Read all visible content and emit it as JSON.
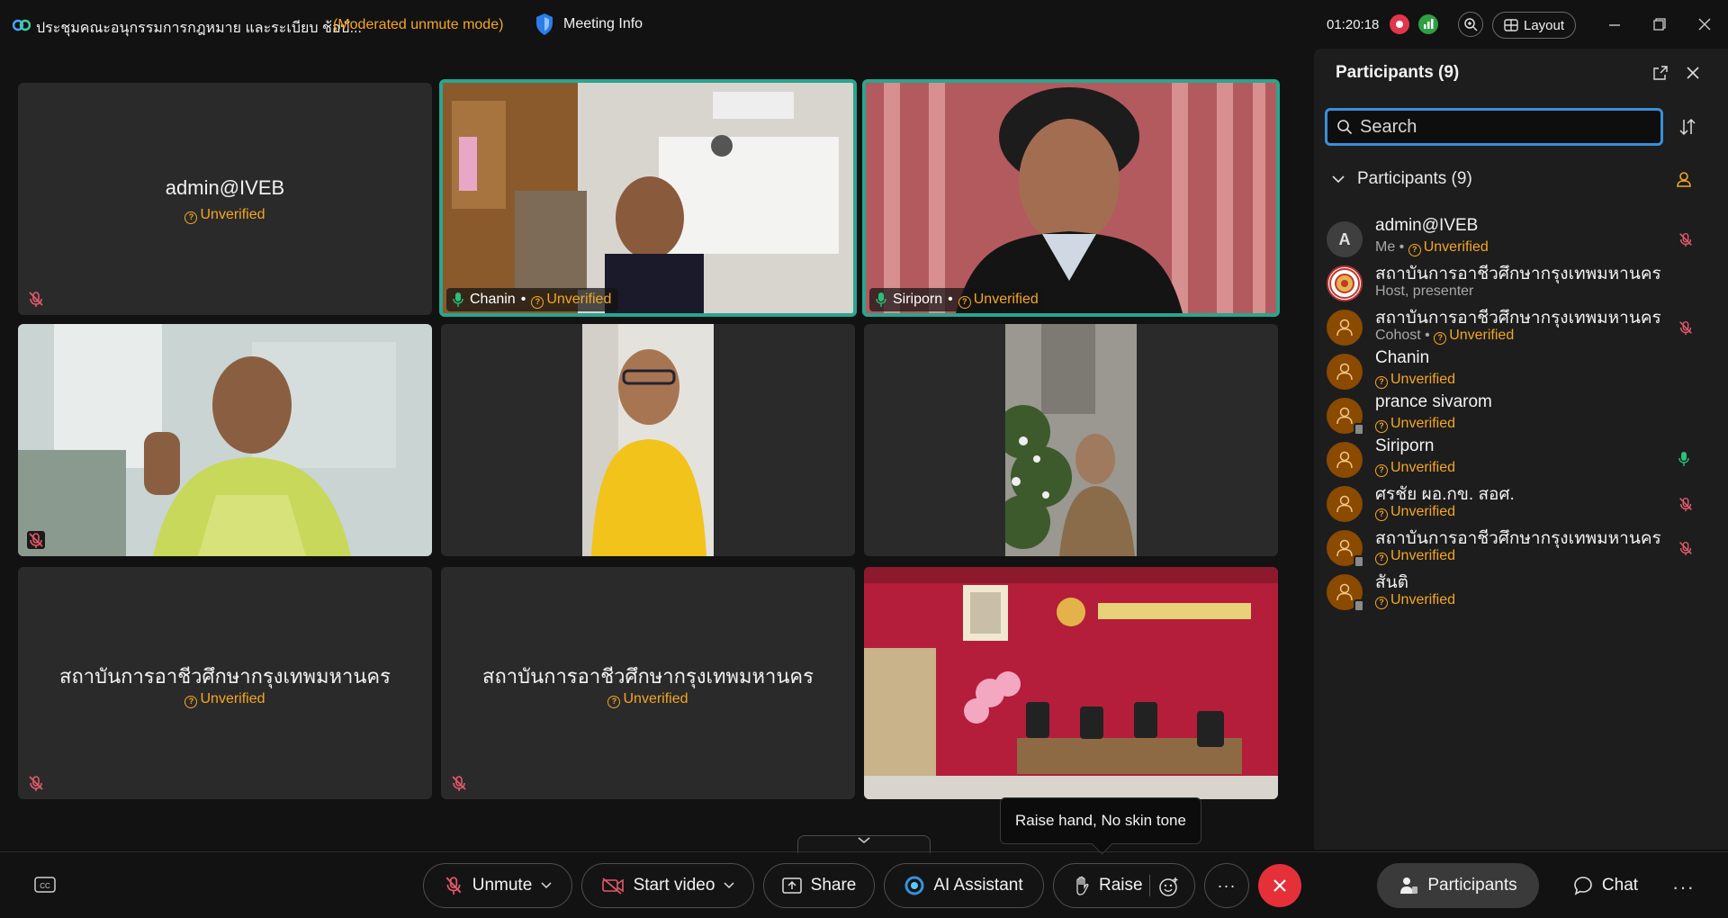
{
  "topbar": {
    "title": "ประชุมคณะอนุกรรมการกฎหมาย และระเบียบ ช้อบั...",
    "mode": "(Moderated unmute mode)",
    "meeting_info": "Meeting Info",
    "timer": "01:20:18",
    "layout": "Layout"
  },
  "tiles": [
    {
      "name": "admin@IVEB",
      "status": "Unverified",
      "muted": true,
      "video": false
    },
    {
      "name": "Chanin",
      "status": "Unverified",
      "muted": false,
      "video": true,
      "active": true
    },
    {
      "name": "Siriporn",
      "status": "Unverified",
      "muted": false,
      "video": true,
      "active": true
    },
    {
      "name": "",
      "status": "",
      "muted": true,
      "video": true
    },
    {
      "name": "",
      "status": "",
      "muted": false,
      "video": true
    },
    {
      "name": "",
      "status": "",
      "muted": false,
      "video": true
    },
    {
      "name": "สถาบันการอาชีวศึกษากรุงเทพมหานคร",
      "status": "Unverified",
      "muted": true,
      "video": false
    },
    {
      "name": "สถาบันการอาชีวศึกษากรุงเทพมหานคร",
      "status": "Unverified",
      "muted": true,
      "video": false
    },
    {
      "name": "",
      "status": "",
      "muted": false,
      "video": true
    }
  ],
  "panel": {
    "title": "Participants (9)",
    "search_placeholder": "Search",
    "section_label": "Participants (9)",
    "participants": [
      {
        "name": "admin@IVEB",
        "prefix": "Me • ",
        "status": "Unverified",
        "avatar": "A",
        "mic": "muted"
      },
      {
        "name": "สถาบันการอาชีวศึกษากรุงเทพมหานคร",
        "prefix": "Host, presenter",
        "status": "",
        "avatar": "logo",
        "mic": "none"
      },
      {
        "name": "สถาบันการอาชีวศึกษากรุงเทพมหานคร",
        "prefix": "Cohost • ",
        "status": "Unverified",
        "avatar": "person",
        "mic": "muted"
      },
      {
        "name": "Chanin",
        "prefix": "",
        "status": "Unverified",
        "avatar": "person",
        "mic": "none"
      },
      {
        "name": "prance sivarom",
        "prefix": "",
        "status": "Unverified",
        "avatar": "person-device",
        "mic": "none"
      },
      {
        "name": "Siriporn",
        "prefix": "",
        "status": "Unverified",
        "avatar": "person",
        "mic": "on"
      },
      {
        "name": "ศรชัย ผอ.กข. สอศ.",
        "prefix": "",
        "status": "Unverified",
        "avatar": "person",
        "mic": "muted"
      },
      {
        "name": "สถาบันการอาชีวศึกษากรุงเทพมหานคร",
        "prefix": "",
        "status": "Unverified",
        "avatar": "person-device",
        "mic": "muted"
      },
      {
        "name": "สันติ",
        "prefix": "",
        "status": "Unverified",
        "avatar": "person-device",
        "mic": "none"
      }
    ]
  },
  "toolbar": {
    "unmute": "Unmute",
    "start_video": "Start video",
    "share": "Share",
    "ai_assistant": "AI Assistant",
    "raise": "Raise",
    "more": "···",
    "participants": "Participants",
    "chat": "Chat",
    "tooltip": "Raise hand, No skin tone"
  },
  "colors": {
    "accent": "#3a8fd9",
    "unverified": "#f5a623",
    "active_border": "#2aa58f",
    "end_call": "#e5303a"
  }
}
